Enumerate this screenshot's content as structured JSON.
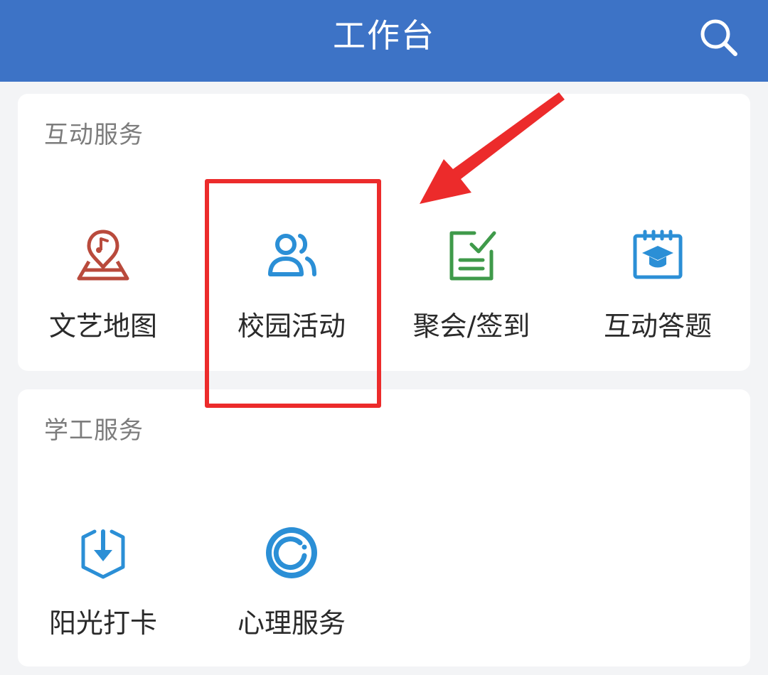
{
  "header": {
    "title": "工作台",
    "search_icon": "search-icon"
  },
  "sections": [
    {
      "title": "互动服务",
      "items": [
        {
          "label": "文艺地图",
          "icon": "map-music-pin-icon",
          "color": "#b94a3c"
        },
        {
          "label": "校园活动",
          "icon": "users-icon",
          "color": "#2b8fd6"
        },
        {
          "label": "聚会/签到",
          "icon": "checklist-icon",
          "color": "#3f9a4a"
        },
        {
          "label": "互动答题",
          "icon": "graduation-cap-icon",
          "color": "#2b8fd6"
        }
      ]
    },
    {
      "title": "学工服务",
      "items": [
        {
          "label": "阳光打卡",
          "icon": "download-badge-icon",
          "color": "#2b8fd6"
        },
        {
          "label": "心理服务",
          "icon": "circle-ring-icon",
          "color": "#2b8fd6"
        }
      ]
    }
  ],
  "colors": {
    "header_bg": "#3d73c6",
    "annotation": "#ec2b2b"
  }
}
